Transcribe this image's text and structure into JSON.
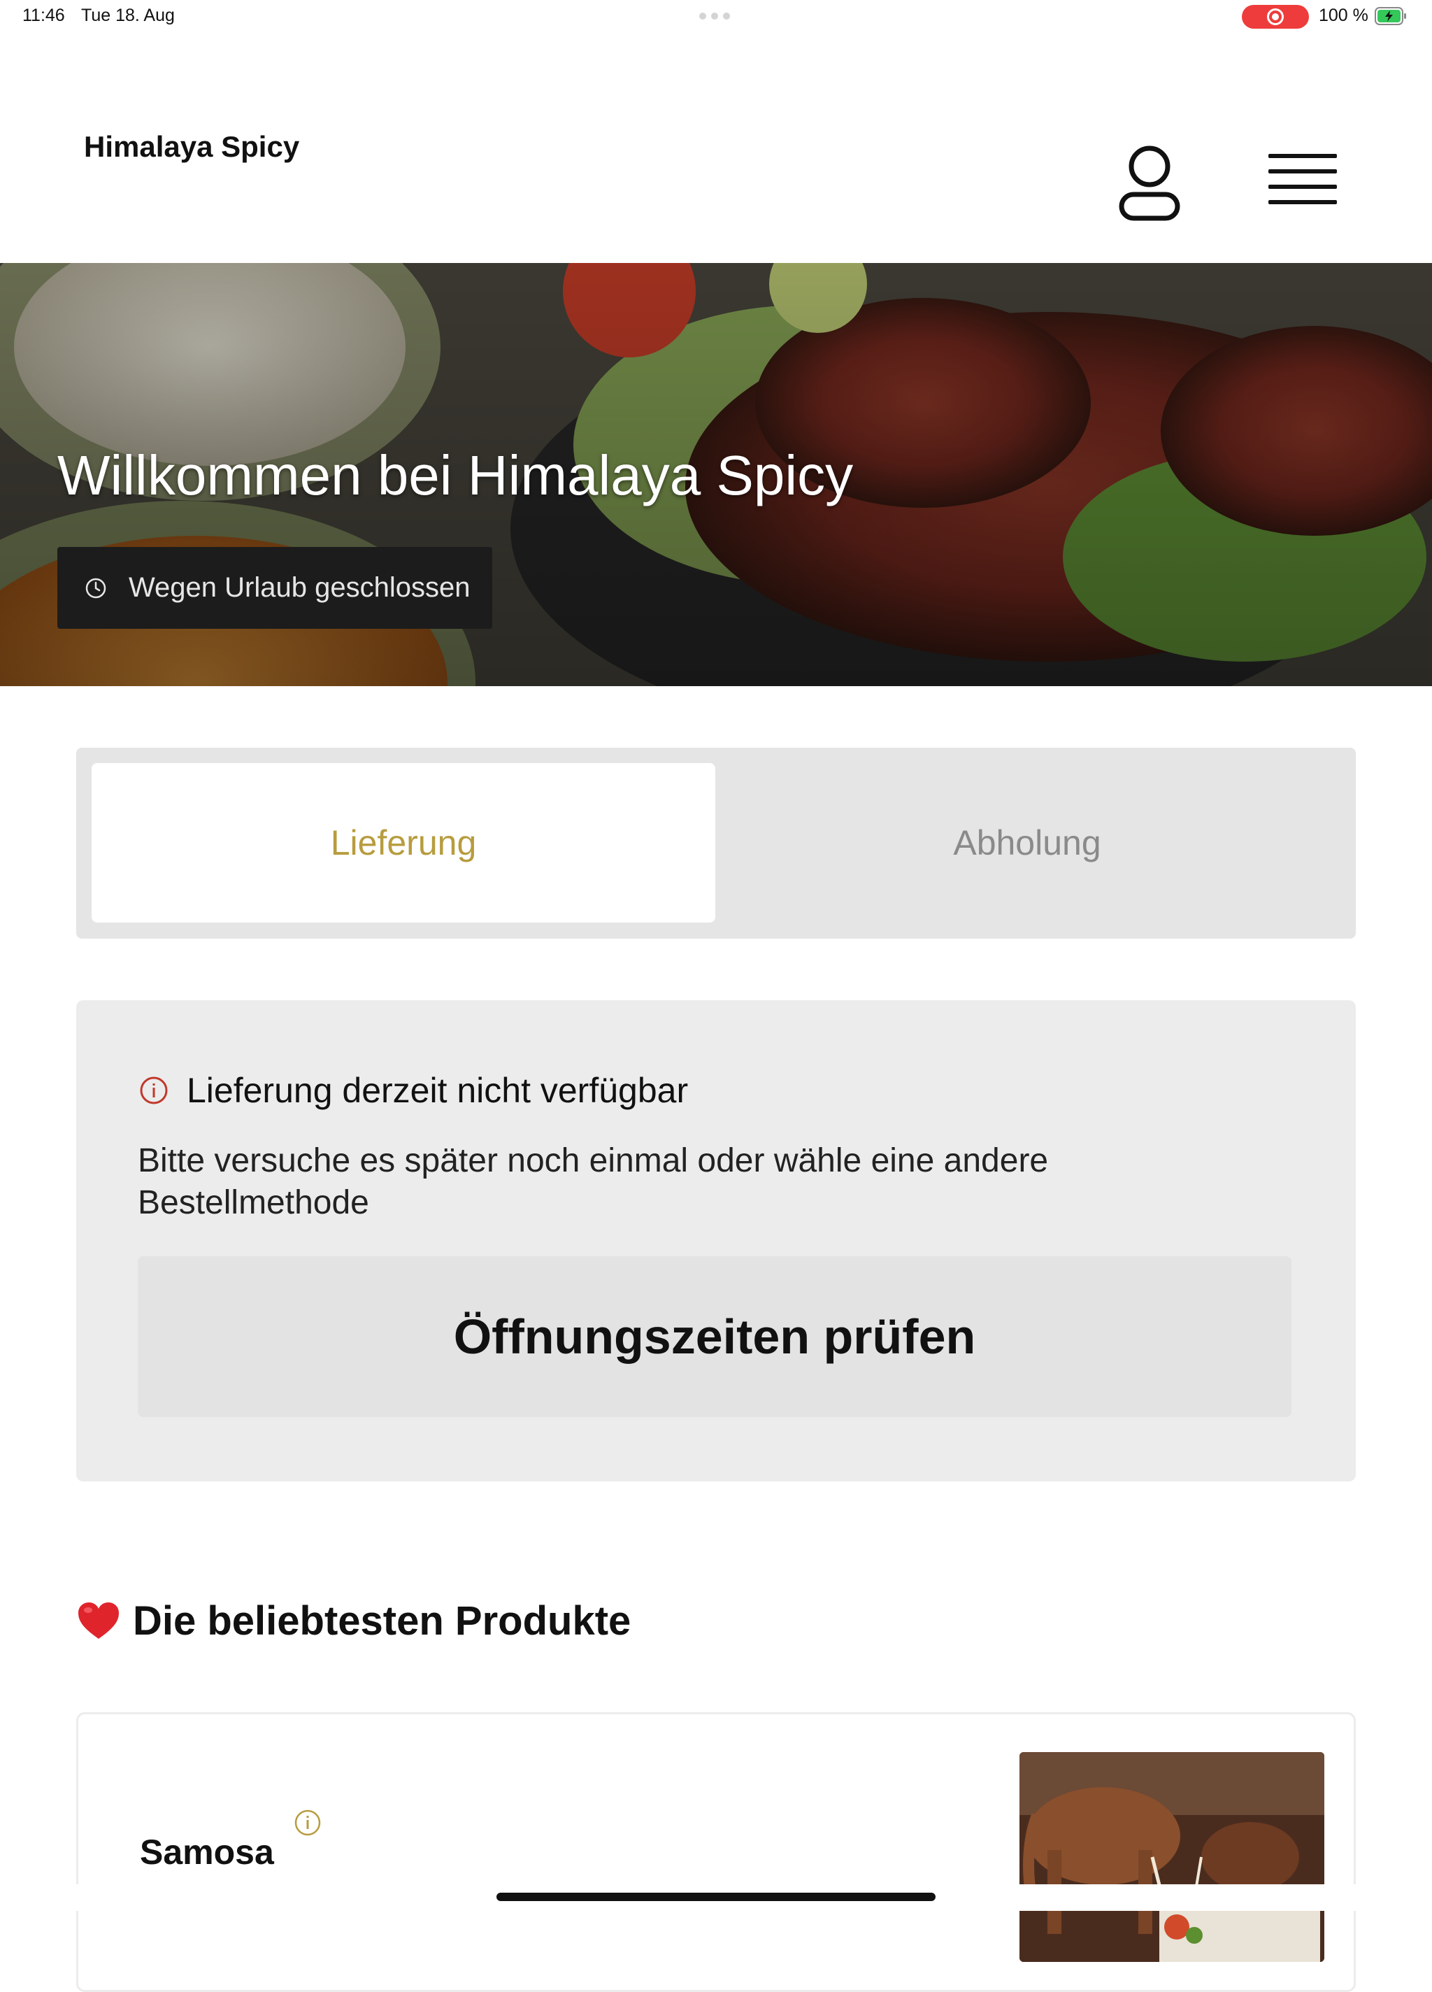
{
  "status_bar": {
    "time": "11:46",
    "date": "Tue 18. Aug",
    "battery_text": "100 %",
    "record_color": "#ee3b3b",
    "battery_color": "#34c759"
  },
  "header": {
    "brand": "Himalaya Spicy",
    "user_icon": "user-icon",
    "menu_icon": "hamburger-menu-icon"
  },
  "hero": {
    "title": "Willkommen bei Himalaya Spicy",
    "status_text": "Wegen Urlaub geschlossen",
    "status_icon": "clock-icon"
  },
  "order_method": {
    "options": [
      {
        "label": "Lieferung",
        "selected": true,
        "color": "#b79c3f"
      },
      {
        "label": "Abholung",
        "selected": false,
        "color": "#8a8a8a"
      }
    ]
  },
  "notice": {
    "icon": "info-circle-icon",
    "icon_color": "#c0392b",
    "title": "Lieferung derzeit nicht verfügbar",
    "text": "Bitte versuche es später noch einmal oder wähle eine andere Bestellmethode",
    "button_label": "Öffnungszeiten prüfen"
  },
  "popular": {
    "icon": "heart-icon",
    "title": "Die beliebtesten Produkte",
    "products": [
      {
        "name": "Samosa",
        "info_icon": "info-circle-icon",
        "accent_color": "#b79c3f"
      }
    ]
  }
}
